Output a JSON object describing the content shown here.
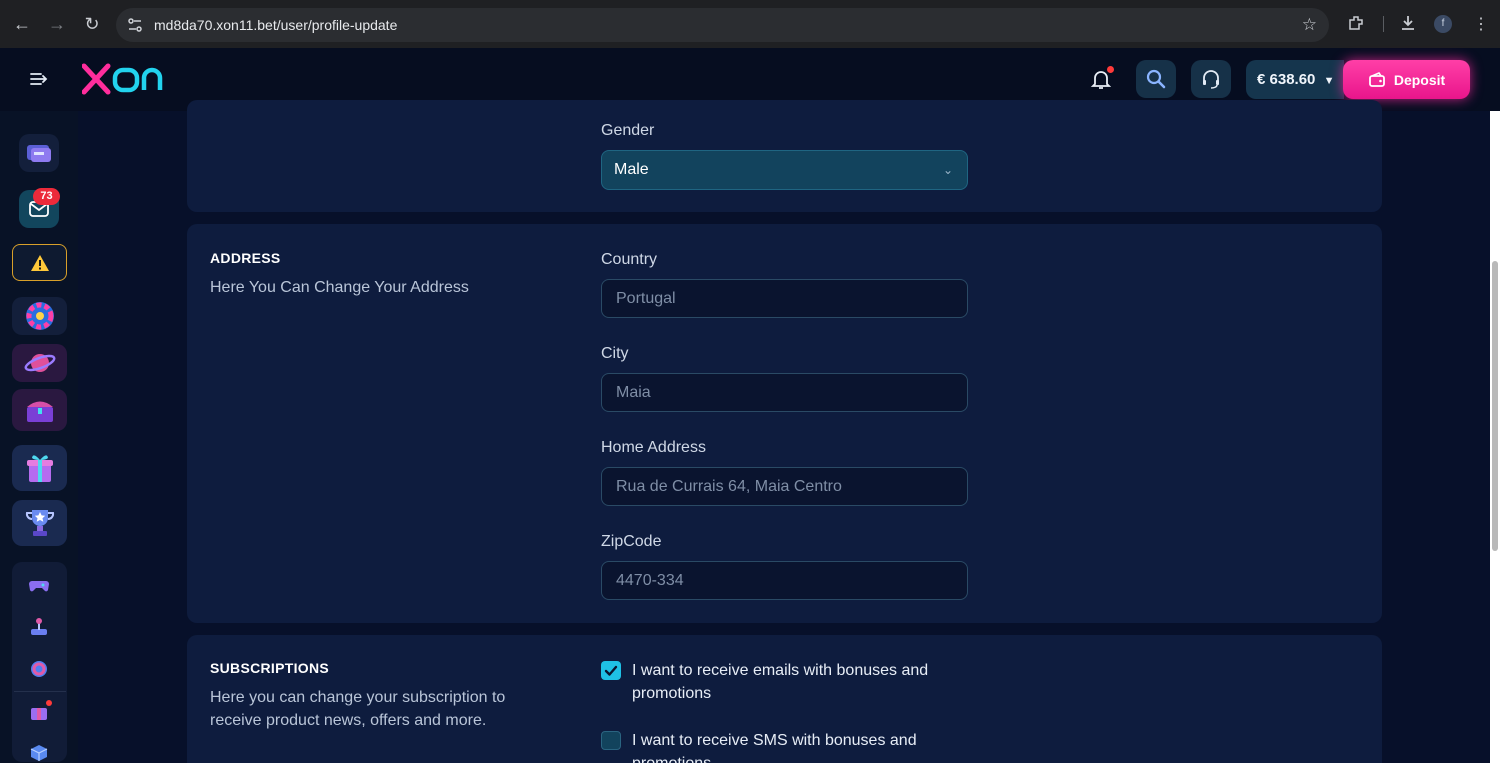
{
  "browser": {
    "url": "md8da70.xon11.bet/user/profile-update",
    "profile_initial": "f"
  },
  "header": {
    "logo_text": "XON",
    "balance": "€ 638.60",
    "deposit_label": "Deposit"
  },
  "sidebar": {
    "messages_badge": "73"
  },
  "personal": {
    "gender_label": "Gender",
    "gender_value": "Male"
  },
  "address": {
    "title": "ADDRESS",
    "description": "Here You Can Change Your Address",
    "country_label": "Country",
    "country_value": "Portugal",
    "city_label": "City",
    "city_value": "Maia",
    "home_label": "Home Address",
    "home_value": "Rua de Currais 64, Maia Centro",
    "zip_label": "ZipCode",
    "zip_value": "4470-334"
  },
  "subscriptions": {
    "title": "SUBSCRIPTIONS",
    "description": "Here you can change your subscription to receive product news, offers and more.",
    "email_option": "I want to receive emails with bonuses and promotions",
    "email_checked": true,
    "sms_option": "I want to receive SMS with bonuses and promotions",
    "sms_checked": false
  },
  "colors": {
    "brand_pink": "#ff2d9c",
    "brand_cyan": "#22d3ee",
    "page_bg": "#07102a",
    "card_bg": "#0e1c3e"
  }
}
